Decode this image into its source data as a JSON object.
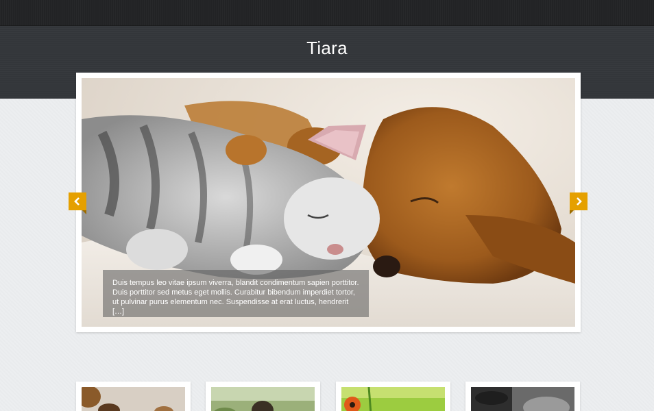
{
  "site": {
    "title": "Tiara"
  },
  "slider": {
    "caption": "Duis tempus leo vitae ipsum viverra, blandit condimentum sapien porttitor. Duis porttitor sed metus eget mollis. Curabitur bibendum imperdiet tortor, ut pulvinar purus elementum nec. Suspendisse at erat luctus, hendrerit […]",
    "prev_icon": "chevron-left-icon",
    "next_icon": "chevron-right-icon"
  },
  "colors": {
    "topbar": "#232426",
    "header": "#34373b",
    "accent": "#e5a000",
    "page_bg": "#eceef0"
  }
}
